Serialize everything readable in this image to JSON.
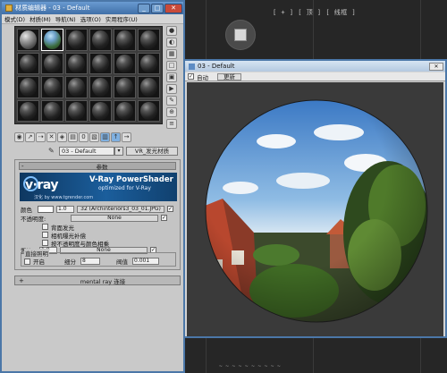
{
  "viewport": {
    "label": "[ + ] [ 顶 ] [ 线框 ]",
    "bottom_text": "~ ~ ~ ~ ~ ~ ~ ~ ~ ~"
  },
  "material_editor": {
    "title": "材质编辑器 - 03 - Default",
    "window_buttons": {
      "minimize": "_",
      "maximize": "□",
      "close": "✕"
    },
    "menu": [
      "模式(D)",
      "材质(M)",
      "导航(N)",
      "选项(O)",
      "实用程序(U)"
    ],
    "slot_count": 24,
    "side_tool_icons": [
      "sample-type-icon",
      "backlight-icon",
      "background-icon",
      "uv-tiling-icon",
      "video-check-icon",
      "make-preview-icon",
      "options-icon",
      "select-by-material-icon",
      "material-map-navigator-icon"
    ],
    "bottom_tool_icons": [
      "get-material-icon",
      "put-to-scene-icon",
      "assign-to-selection-icon",
      "reset-map-icon",
      "make-unique-icon",
      "put-to-library-icon",
      "material-id-icon",
      "show-map-icon",
      "show-end-result-icon",
      "go-to-parent-icon",
      "go-forward-icon"
    ],
    "material_name": "03 - Default",
    "material_name_arrow": "▾",
    "material_type": "VR_发光材质",
    "params": {
      "toggle": "-",
      "title": "参数",
      "vray_banner": {
        "logo": "v·ray",
        "title": "V-Ray PowerShader",
        "subtitle": "optimized for V-Ray",
        "url": "汉化 by www.tgrender.com"
      },
      "color_label": "颜色",
      "color_value": "1.0",
      "color_map": "32 (Archinteriors3_03_01.JPG)",
      "opacity_label": "不透明度:",
      "opacity_map": "None",
      "backface_label": "背面发光",
      "compensate_label": "相机曝光补偿",
      "multiply_label": "按不透明度与颜色相乘",
      "displace_label": "置换:",
      "displace_value": "1.0",
      "displace_map": "None",
      "direct_light_label": "直接照明",
      "on_label": "开启",
      "subdiv_label": "细分",
      "subdiv_value": "8",
      "cutoff_label": "阀值",
      "cutoff_value": "0.001"
    },
    "mental_ray": {
      "toggle": "+",
      "title": "mental ray 连接"
    }
  },
  "preview": {
    "title": "03 - Default",
    "close": "✕",
    "auto_label": "自动",
    "auto_checked": "✓",
    "update_label": "更新"
  }
}
